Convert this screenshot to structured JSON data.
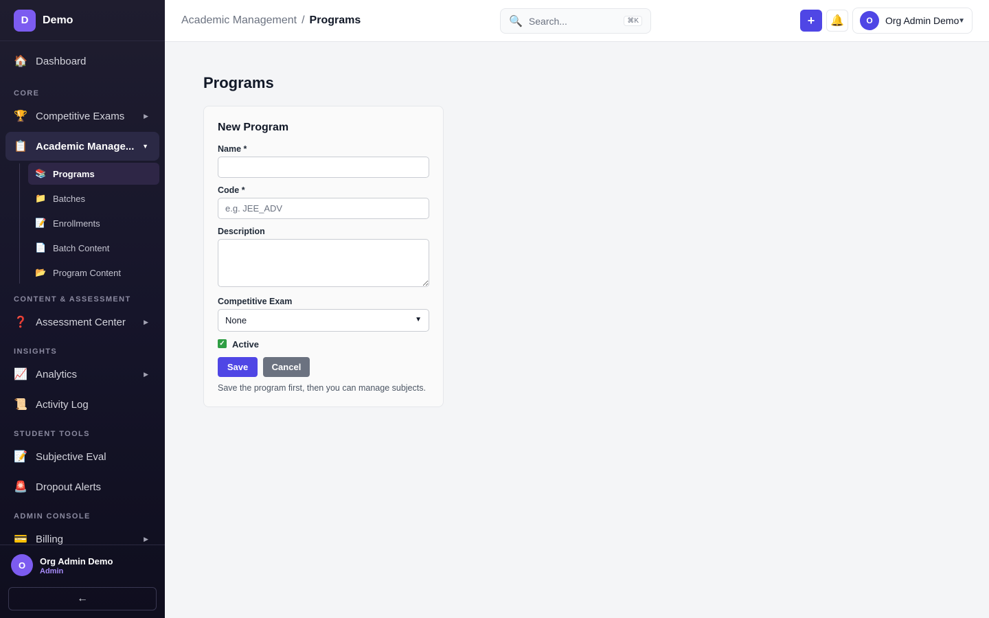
{
  "brand": {
    "logo_letter": "D",
    "name": "Demo"
  },
  "sidebar": {
    "sections": [
      "CORE",
      "CONTENT & ASSESSMENT",
      "INSIGHTS",
      "STUDENT TOOLS",
      "ADMIN CONSOLE"
    ],
    "items": [
      {
        "label": "Dashboard",
        "icon": "house-icon"
      },
      {
        "label": "Competitive Exams",
        "icon": "trophy-icon"
      },
      {
        "label": "Academic Manage...",
        "icon": "clipboard-icon"
      },
      {
        "label": "Assessment Center",
        "icon": "question-icon"
      },
      {
        "label": "Analytics",
        "icon": "chart-icon"
      },
      {
        "label": "Activity Log",
        "icon": "scroll-icon"
      },
      {
        "label": "Subjective Eval",
        "icon": "memo-icon"
      },
      {
        "label": "Dropout Alerts",
        "icon": "siren-icon"
      },
      {
        "label": "Billing",
        "icon": "card-icon"
      }
    ],
    "sub_items": [
      {
        "label": "Programs",
        "icon": "books-icon"
      },
      {
        "label": "Batches",
        "icon": "folder-icon"
      },
      {
        "label": "Enrollments",
        "icon": "memo-icon"
      },
      {
        "label": "Batch Content",
        "icon": "page-icon"
      },
      {
        "label": "Program Content",
        "icon": "open-folder-icon"
      }
    ],
    "user": {
      "avatar_letter": "O",
      "name": "Org Admin Demo",
      "role": "Admin"
    },
    "collapse_label": "←"
  },
  "header": {
    "breadcrumb": {
      "parent": "Academic Management",
      "separator": "/",
      "current": "Programs"
    },
    "search": {
      "placeholder": "Search...",
      "shortcut": "⌘K"
    },
    "add_label": "+",
    "profile": {
      "avatar_letter": "O",
      "name": "Org Admin Demo"
    }
  },
  "main": {
    "title": "Programs",
    "form": {
      "title": "New Program",
      "name_label": "Name *",
      "name_value": "",
      "code_label": "Code *",
      "code_placeholder": "e.g. JEE_ADV",
      "description_label": "Description",
      "exam_label": "Competitive Exam",
      "exam_selected": "None",
      "active_label": "Active",
      "active_checked": true,
      "save_label": "Save",
      "cancel_label": "Cancel",
      "hint": "Save the program first, then you can manage subjects."
    }
  },
  "colors": {
    "accent": "#4f46e5",
    "brand": "#7c5cf0",
    "checkbox": "#2f9e44"
  }
}
